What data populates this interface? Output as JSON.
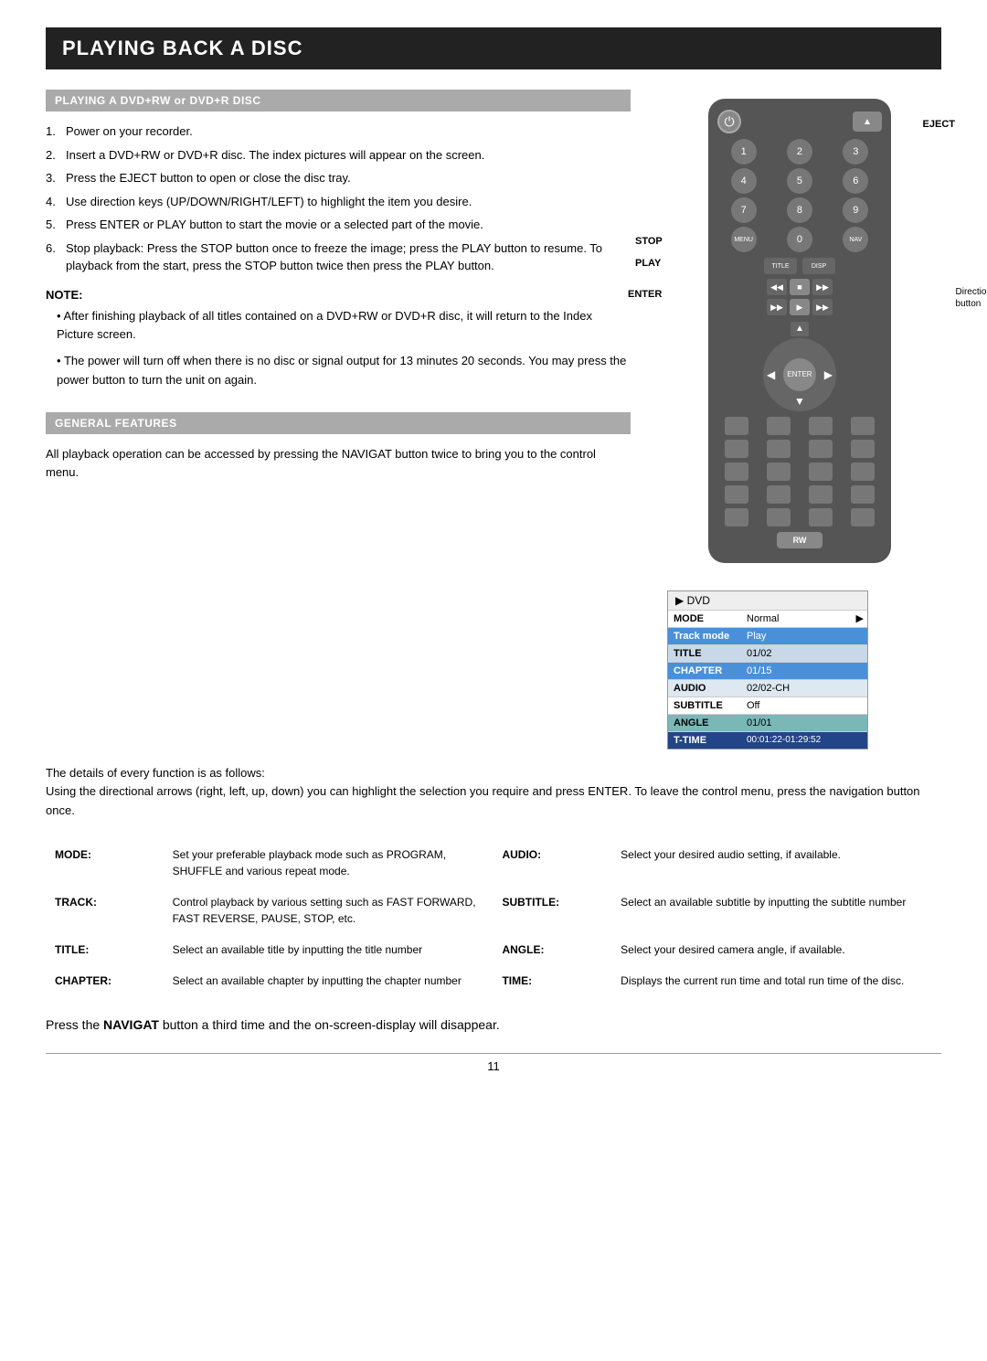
{
  "page": {
    "title": "PLAYING BACK A DISC",
    "number": "11"
  },
  "section1": {
    "header": "PLAYING A DVD+RW or DVD+R DISC",
    "steps": [
      {
        "num": "1.",
        "text": "Power on your recorder."
      },
      {
        "num": "2.",
        "text": "Insert a DVD+RW or DVD+R disc. The index pictures will appear on the screen."
      },
      {
        "num": "3.",
        "text": "Press the EJECT button to open or close the disc tray."
      },
      {
        "num": "4.",
        "text": "Use direction keys (UP/DOWN/RIGHT/LEFT) to highlight the item you desire."
      },
      {
        "num": "5.",
        "text": "Press ENTER or PLAY button to start the movie or a selected part of the movie."
      },
      {
        "num": "6.",
        "text": "Stop playback: Press the STOP button once to freeze the image; press the PLAY button to resume. To playback from the start, press the STOP button twice then press the PLAY button."
      }
    ],
    "note_label": "NOTE:",
    "notes": [
      "After finishing playback of all titles contained on a DVD+RW or DVD+R disc, it will return to the Index Picture screen.",
      "The power will turn off when there is no disc or signal output for 13 minutes 20 seconds. You may press the power button to turn the unit on again."
    ]
  },
  "remote": {
    "standby_icon": "⏻",
    "eject_icon": "▲",
    "eject_label": "EJECT",
    "numkeys": [
      "1",
      "2",
      "3",
      "4",
      "5",
      "6",
      "7",
      "8",
      "9",
      "",
      "0",
      ""
    ],
    "stop_label": "STOP",
    "play_label": "PLAY",
    "enter_label": "ENTER",
    "enter_center": "ENTER",
    "direction_label": "Direction\nbutton",
    "transport_btns": [
      "◀◀",
      "■",
      "▶▶"
    ],
    "play_btns": [
      "▶▶",
      "▶",
      "▶▶"
    ],
    "logo": "RW"
  },
  "osd": {
    "header": "▶ DVD",
    "rows": [
      {
        "label": "MODE",
        "value": "Normal",
        "arrow": "▶",
        "style": "normal"
      },
      {
        "label": "Track mode",
        "value": "Play",
        "arrow": "",
        "style": "highlighted"
      },
      {
        "label": "TITLE",
        "value": "01/02",
        "arrow": "",
        "style": "alt-bg"
      },
      {
        "label": "CHAPTER",
        "value": "01/15",
        "arrow": "",
        "style": "highlighted"
      },
      {
        "label": "AUDIO",
        "value": "02/02-CH",
        "arrow": "",
        "style": "alt-bg2"
      },
      {
        "label": "SUBTITLE",
        "value": "Off",
        "arrow": "",
        "style": "normal"
      },
      {
        "label": "ANGLE",
        "value": "01/01",
        "arrow": "",
        "style": "teal-bg"
      },
      {
        "label": "T-TIME",
        "value": "00:01:22-01:29:52",
        "arrow": "",
        "style": "dark-blue"
      }
    ]
  },
  "section2": {
    "header": "GENERAL FEATURES",
    "general_text": "All playback operation can be accessed by pressing the NAVIGAT button twice to bring you to the control menu.",
    "details_intro": "The details of every function is as follows:\nUsing the directional arrows (right, left, up, down) you can highlight the selection you require and press ENTER. To leave the control menu, press the navigation button once.",
    "features": [
      {
        "label": "MODE:",
        "desc": "Set your preferable playback mode such as PROGRAM, SHUFFLE and various repeat mode.",
        "label2": "AUDIO:",
        "desc2": "Select your desired audio setting, if available."
      },
      {
        "label": "TRACK:",
        "desc": "Control playback by various setting such as FAST FORWARD, FAST REVERSE, PAUSE, STOP, etc.",
        "label2": "SUBTITLE:",
        "desc2": "Select an available subtitle by inputting the subtitle number"
      },
      {
        "label": "TITLE:",
        "desc": "Select an available title by inputting the title number",
        "label2": "ANGLE:",
        "desc2": "Select your desired camera angle, if available."
      },
      {
        "label": "CHAPTER:",
        "desc": "Select an available chapter by inputting the chapter number",
        "label2": "TIME:",
        "desc2": "Displays the current run time and total run time of the disc."
      }
    ],
    "final_note": "Press the NAVIGAT button a third time and the on-screen-display will disappear."
  }
}
